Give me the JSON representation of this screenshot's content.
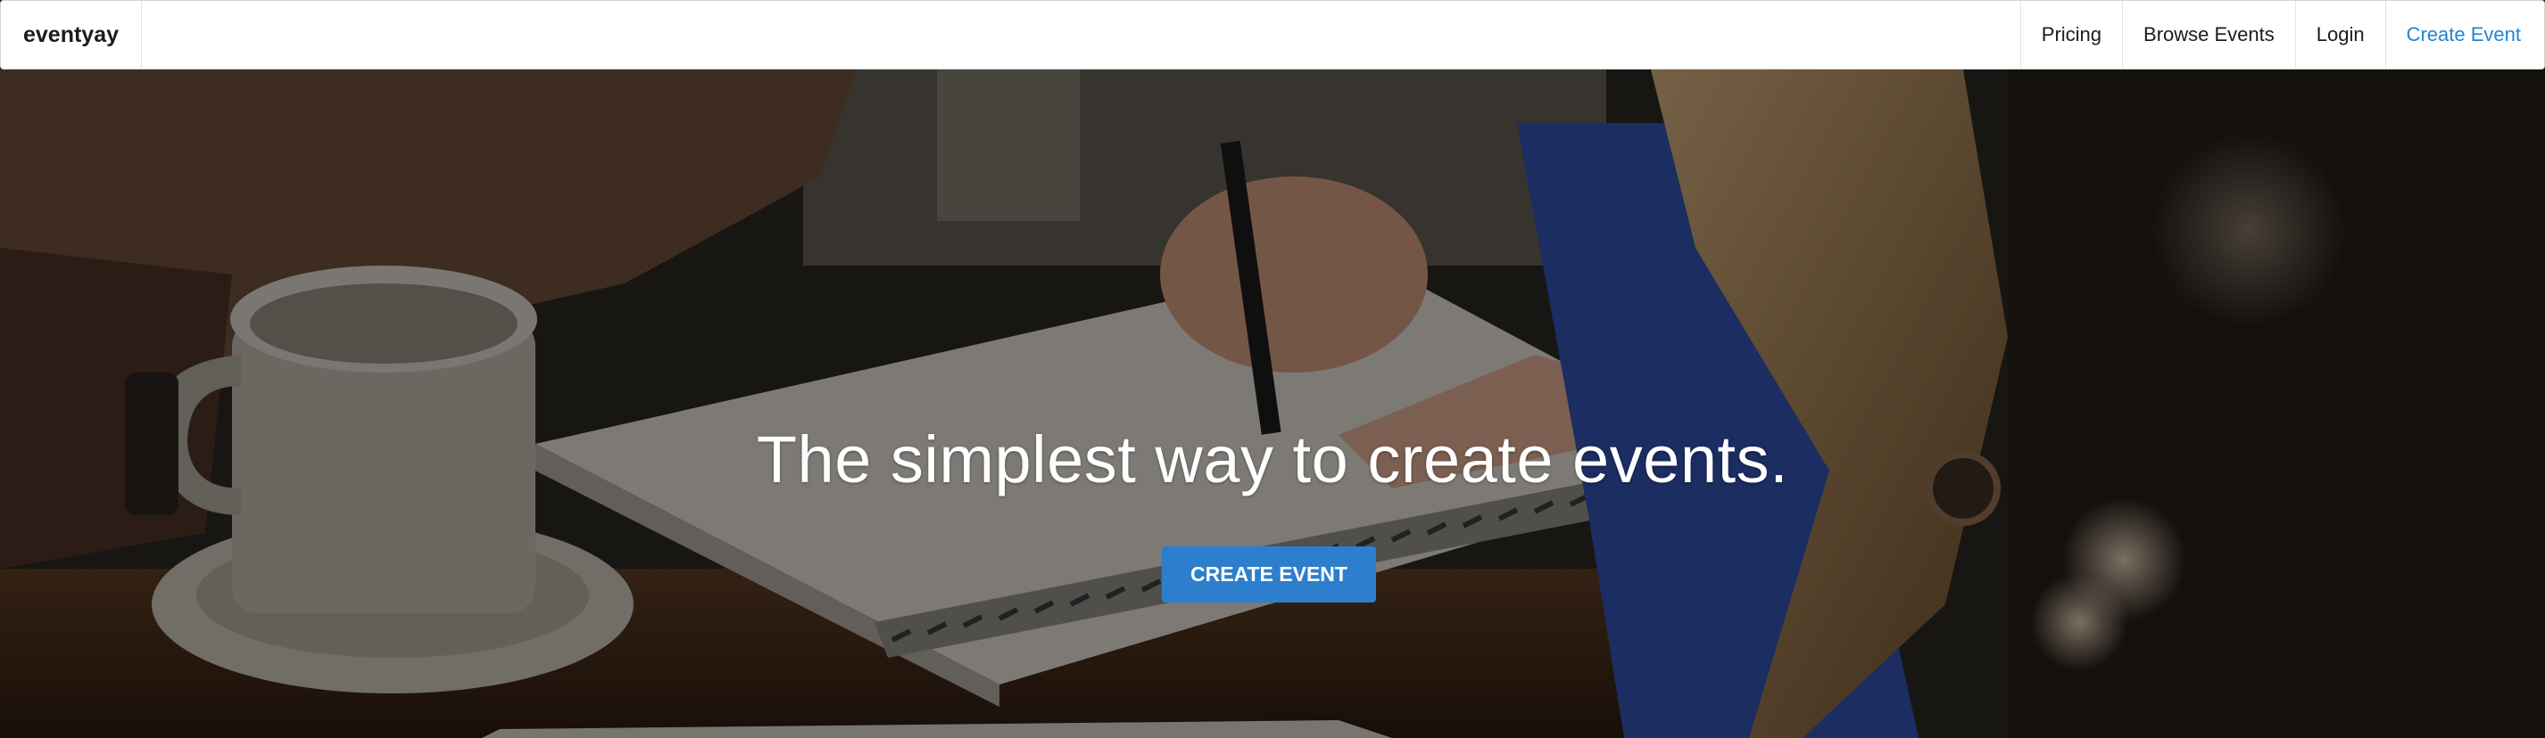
{
  "navbar": {
    "brand": "eventyay",
    "items": [
      {
        "label": "Pricing"
      },
      {
        "label": "Browse Events"
      },
      {
        "label": "Login"
      },
      {
        "label": "Create Event"
      }
    ]
  },
  "hero": {
    "headline": "The simplest way to create events.",
    "cta_label": "CREATE EVENT",
    "background_image": "photo of people writing in a spiral notebook next to a coffee mug"
  },
  "colors": {
    "accent": "#2185d0",
    "button": "#2d7fce",
    "navbar_bg": "#ffffff",
    "headline": "#ffffff"
  }
}
